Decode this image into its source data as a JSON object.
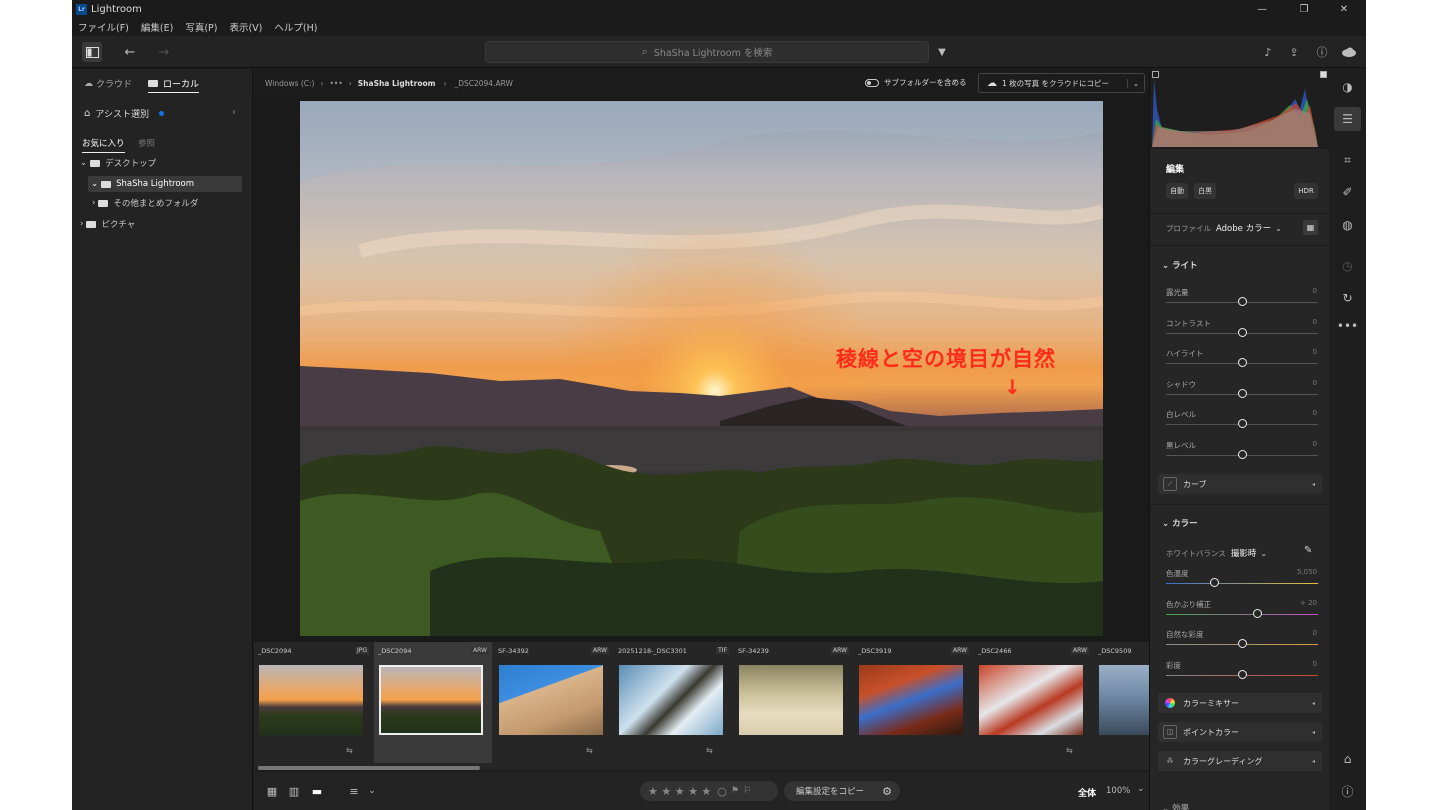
{
  "app": {
    "title": "Lightroom",
    "logo": "Lr"
  },
  "menu": [
    "ファイル(F)",
    "編集(E)",
    "写真(P)",
    "表示(V)",
    "ヘルプ(H)"
  ],
  "toolbar": {
    "search_placeholder": "ShaSha Lightroom を検索"
  },
  "left": {
    "tabs": {
      "cloud": "クラウド",
      "local": "ローカル"
    },
    "assist": "アシスト選別",
    "subtabs": {
      "favorites": "お気に入り",
      "browse": "参照"
    },
    "tree": [
      "デスクトップ",
      "ShaSha Lightroom",
      "その他まとめフォルダ",
      "ピクチャ"
    ]
  },
  "breadcrumb": {
    "drive": "Windows (C:)",
    "more": "•••",
    "folder": "ShaSha Lightroom",
    "file": "_DSC2094.ARW",
    "subfolder": "サブフォルダーを含める",
    "copy": "1 枚の写真 をクラウドにコピー"
  },
  "photo": {
    "annotation": "稜線と空の境目が自然",
    "arrow": "↓"
  },
  "filmstrip": [
    {
      "name": "_DSC2094",
      "type": "JPG",
      "adj": "⇆"
    },
    {
      "name": "_DSC2094",
      "type": "ARW",
      "adj": "⇆"
    },
    {
      "name": "SF-34392",
      "type": "ARW",
      "adj": "⇆"
    },
    {
      "name": "20251218-_DSC3301",
      "type": "TIF",
      "adj": "⇆"
    },
    {
      "name": "SF-34239",
      "type": "ARW",
      "adj": ""
    },
    {
      "name": "_DSC3919",
      "type": "ARW",
      "adj": ""
    },
    {
      "name": "_DSC2466",
      "type": "ARW",
      "adj": "⇆"
    },
    {
      "name": "_DSC9509",
      "type": "",
      "adj": ""
    }
  ],
  "bottom": {
    "stars": "★ ★ ★ ★ ★",
    "copy_settings": "編集設定をコピー",
    "fit": "全体",
    "zoom": "100%"
  },
  "edit": {
    "title": "編集",
    "auto": "自動",
    "bw": "白黒",
    "hdr": "HDR",
    "profile_label": "プロファイル",
    "profile_value": "Adobe カラー",
    "light": "ライト",
    "light_sliders": [
      {
        "label": "露光量",
        "value": "0",
        "pos": 0.5
      },
      {
        "label": "コントラスト",
        "value": "0",
        "pos": 0.5
      },
      {
        "label": "ハイライト",
        "value": "0",
        "pos": 0.5
      },
      {
        "label": "シャドウ",
        "value": "0",
        "pos": 0.5
      },
      {
        "label": "白レベル",
        "value": "0",
        "pos": 0.5
      },
      {
        "label": "黒レベル",
        "value": "0",
        "pos": 0.5
      }
    ],
    "curve": "カーブ",
    "color": "カラー",
    "wb_label": "ホワイトバランス",
    "wb_value": "撮影時",
    "color_sliders": [
      {
        "label": "色温度",
        "value": "5,050",
        "pos": 0.32
      },
      {
        "label": "色かぶり補正",
        "value": "+ 20",
        "pos": 0.6
      },
      {
        "label": "自然な彩度",
        "value": "0",
        "pos": 0.5
      },
      {
        "label": "彩度",
        "value": "0",
        "pos": 0.5
      }
    ],
    "rows": [
      "カラーミキサー",
      "ポイントカラー",
      "カラーグレーディング"
    ],
    "effects": "効果"
  },
  "colors": {
    "accent": "#1473e6",
    "annotation": "#ff2b1a"
  }
}
